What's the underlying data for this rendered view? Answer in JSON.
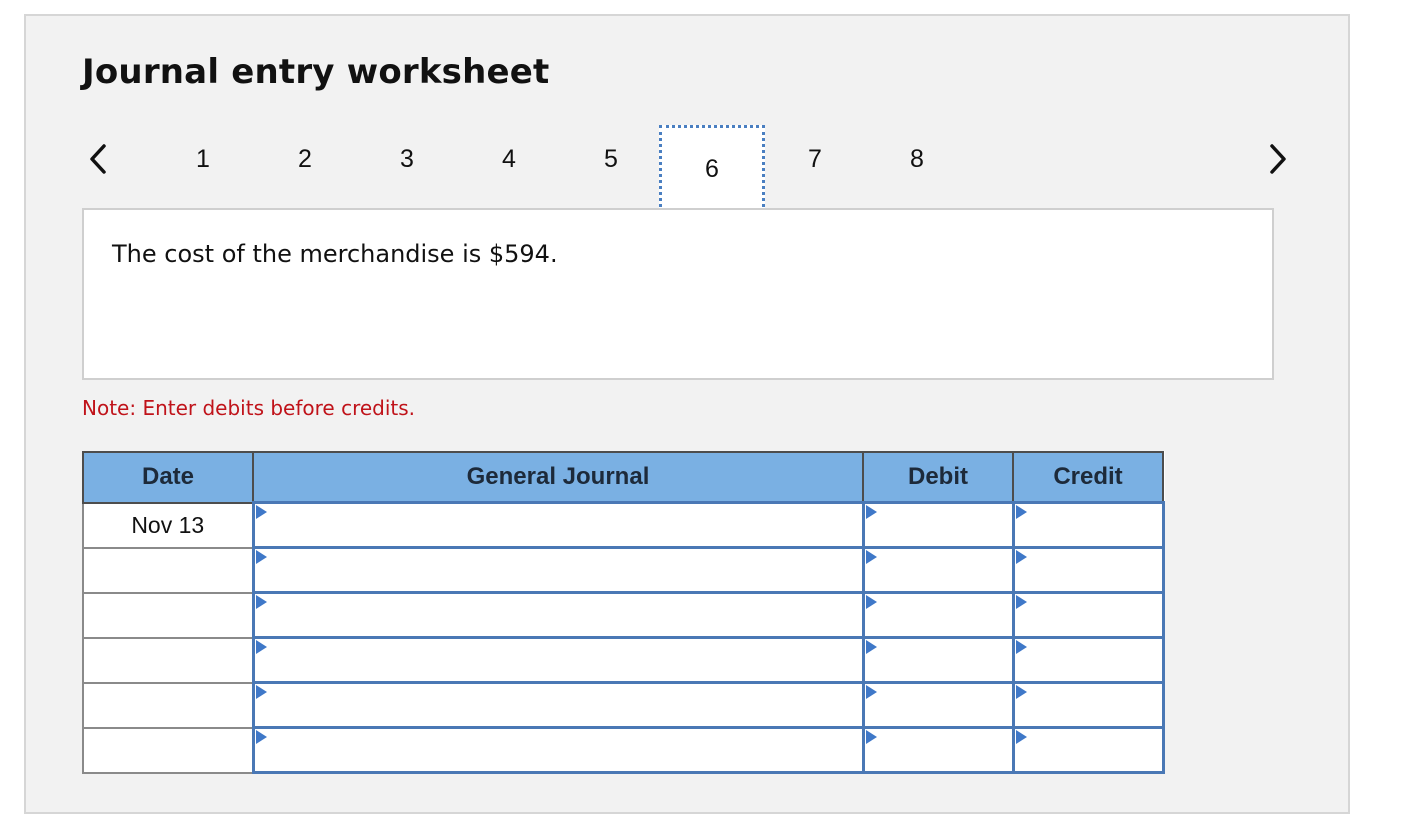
{
  "worksheet": {
    "title": "Journal entry worksheet",
    "pages": [
      "1",
      "2",
      "3",
      "4",
      "5",
      "6",
      "7",
      "8"
    ],
    "active_page": "6",
    "prev_icon": "chevron-left-icon",
    "next_icon": "chevron-right-icon",
    "description": "The cost of the merchandise is $594.",
    "note": "Note: Enter debits before credits."
  },
  "journal": {
    "headers": {
      "date": "Date",
      "general_journal": "General Journal",
      "debit": "Debit",
      "credit": "Credit"
    },
    "rows": [
      {
        "date": "Nov 13",
        "account": "",
        "debit": "",
        "credit": ""
      },
      {
        "date": "",
        "account": "",
        "debit": "",
        "credit": ""
      },
      {
        "date": "",
        "account": "",
        "debit": "",
        "credit": ""
      },
      {
        "date": "",
        "account": "",
        "debit": "",
        "credit": ""
      },
      {
        "date": "",
        "account": "",
        "debit": "",
        "credit": ""
      },
      {
        "date": "",
        "account": "",
        "debit": "",
        "credit": ""
      }
    ]
  },
  "colors": {
    "header_fill": "#7ab0e3",
    "input_border": "#4a78b5",
    "note_text": "#c0131a",
    "active_page_border": "#4a7fc1"
  }
}
